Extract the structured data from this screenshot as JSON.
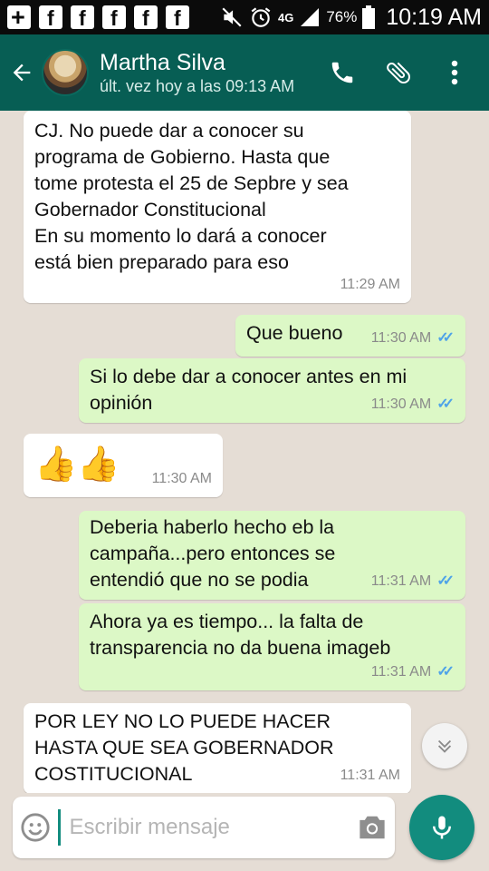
{
  "status_bar": {
    "time": "10:19 AM",
    "battery": "76%",
    "network": "4G",
    "icons": [
      "plus-icon",
      "facebook-icon",
      "facebook-icon",
      "facebook-icon",
      "facebook-icon",
      "facebook-icon",
      "mute-icon",
      "alarm-icon",
      "signal-icon",
      "battery-icon"
    ]
  },
  "header": {
    "contact_name": "Martha Silva",
    "last_seen": "últ. vez hoy a las 09:13 AM",
    "actions": [
      "phone-icon",
      "attach-icon",
      "more-icon"
    ]
  },
  "messages": [
    {
      "direction": "in",
      "text": "CJ. No puede dar a conocer su\nprograma de Gobierno. Hasta que\ntome protesta el 25 de Sepbre y sea\nGobernador Constitucional\nEn su momento lo dará a conocer\nestá bien preparado para eso",
      "time": "11:29 AM"
    },
    {
      "direction": "out",
      "text": "Que bueno",
      "time": "11:30 AM",
      "read": true
    },
    {
      "direction": "out",
      "text": "Si lo debe dar a conocer antes en mi\nopinión",
      "time": "11:30 AM",
      "read": true
    },
    {
      "direction": "in",
      "text": "👍👍",
      "time": "11:30 AM"
    },
    {
      "direction": "out",
      "text": "Deberia haberlo hecho eb la\ncampaña...pero entonces se\nentendió que no se podia",
      "time": "11:31 AM",
      "read": true
    },
    {
      "direction": "out",
      "text": "Ahora ya es tiempo... la falta de\ntransparencia no da buena imageb",
      "time": "11:31 AM",
      "read": true
    },
    {
      "direction": "in",
      "text": "POR LEY NO LO PUEDE HACER\nHASTA QUE SEA GOBERNADOR\nCOSTITUCIONAL",
      "time": "11:31 AM"
    }
  ],
  "composer": {
    "placeholder": "Escribir mensaje",
    "value": ""
  },
  "colors": {
    "header": "#075e54",
    "outgoing_bubble": "#dcf8c6",
    "incoming_bubble": "#ffffff",
    "chat_background": "#e5ddd5",
    "accent": "#128c7e",
    "read_ticks": "#4fa3e8"
  }
}
